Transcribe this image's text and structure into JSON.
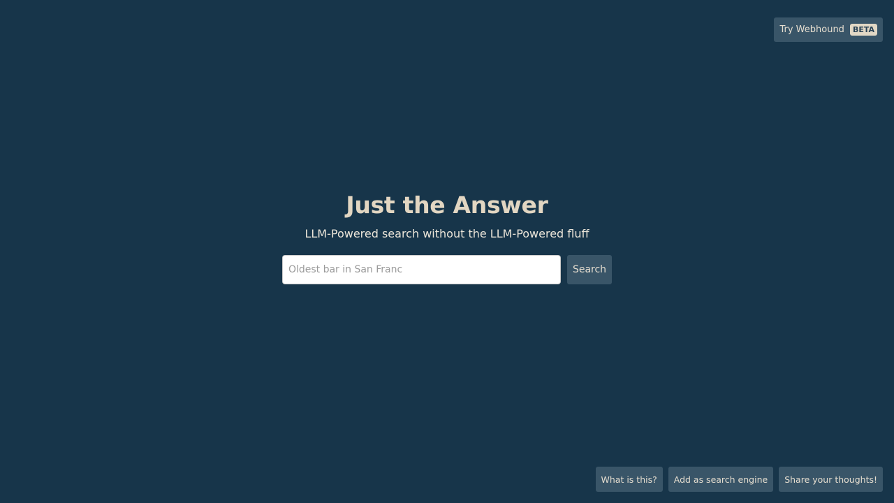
{
  "header": {
    "webhound_label": "Try Webhound",
    "beta_badge": "BETA"
  },
  "main": {
    "title": "Just the Answer",
    "subtitle": "LLM-Powered search without the LLM-Powered fluff",
    "search": {
      "value": "",
      "placeholder": "Oldest bar in San Franc",
      "button_label": "Search"
    }
  },
  "footer": {
    "what_is_this": "What is this?",
    "add_search_engine": "Add as search engine",
    "share_thoughts": "Share your thoughts!"
  },
  "colors": {
    "background": "#17354a",
    "button": "#395568",
    "title": "#e2d6c2"
  }
}
